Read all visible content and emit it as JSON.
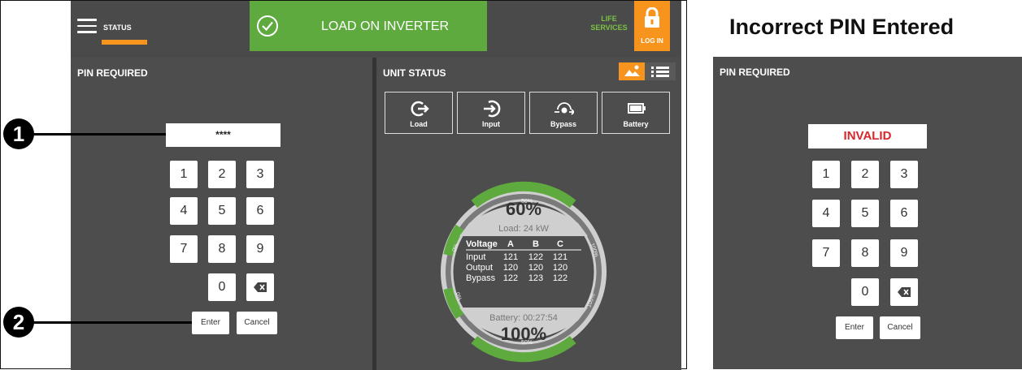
{
  "topbar": {
    "status_tab": "STATUS",
    "banner_text": "LOAD ON INVERTER",
    "life_services": "LIFE SERVICES",
    "login_label": "LOG IN"
  },
  "pin_panel": {
    "title": "PIN REQUIRED",
    "pin_value": "****",
    "keys": [
      "1",
      "2",
      "3",
      "4",
      "5",
      "6",
      "7",
      "8",
      "9",
      "0"
    ],
    "enter_label": "Enter",
    "cancel_label": "Cancel"
  },
  "unit_panel": {
    "title": "UNIT STATUS",
    "buttons": [
      "Load",
      "Input",
      "Bypass",
      "Battery"
    ],
    "gauge": {
      "load_percent": "60%",
      "load_text": "Load: 24 kW",
      "headers": [
        "Voltage",
        "A",
        "B",
        "C"
      ],
      "rows": [
        [
          "Input",
          "121",
          "122",
          "121"
        ],
        [
          "Output",
          "120",
          "120",
          "120"
        ],
        [
          "Bypass",
          "122",
          "123",
          "122"
        ]
      ],
      "battery_text": "Battery: 00:27:54",
      "battery_percent": "100%",
      "tick_labels": [
        "50%",
        "0%",
        "100%",
        "0%",
        "100%",
        "50%"
      ]
    }
  },
  "callouts": [
    "1",
    "2"
  ],
  "incorrect": {
    "title": "Incorrect PIN Entered",
    "panel_title": "PIN REQUIRED",
    "pin_value": "INVALID",
    "keys": [
      "1",
      "2",
      "3",
      "4",
      "5",
      "6",
      "7",
      "8",
      "9",
      "0"
    ],
    "enter_label": "Enter",
    "cancel_label": "Cancel"
  },
  "colors": {
    "panel_bg": "#4d4d4d",
    "accent_orange": "#f7941d",
    "green": "#5eaa3f",
    "invalid_red": "#d9262b"
  }
}
